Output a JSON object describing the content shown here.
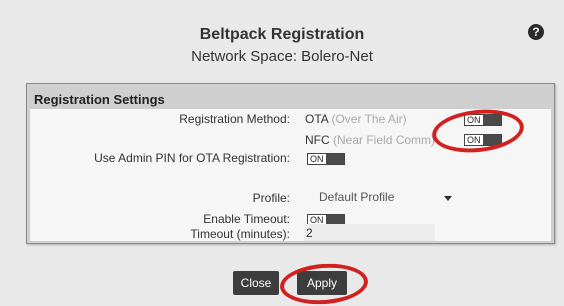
{
  "dialog": {
    "title": "Beltpack Registration",
    "subtitle": "Network Space: Bolero-Net",
    "help_icon": "question-circle-icon"
  },
  "panel": {
    "header": "Registration Settings",
    "registration_method": {
      "label": "Registration Method:",
      "options": [
        {
          "name": "OTA",
          "desc": "(Over The Air)",
          "toggle": "ON"
        },
        {
          "name": "NFC",
          "desc": "(Near Field Comm)",
          "toggle": "ON"
        }
      ]
    },
    "admin_pin": {
      "label": "Use Admin PIN for OTA Registration:",
      "toggle": "ON"
    },
    "profile": {
      "label": "Profile:",
      "value": "Default Profile"
    },
    "enable_timeout": {
      "label": "Enable Timeout:",
      "toggle": "ON"
    },
    "timeout_minutes": {
      "label": "Timeout (minutes):",
      "value": "2"
    }
  },
  "buttons": {
    "close": "Close",
    "apply": "Apply"
  },
  "colors": {
    "background": "#e9e9e9",
    "panel": "#cfcfcf",
    "button": "#3d3d3d",
    "annotation": "#d02020"
  }
}
